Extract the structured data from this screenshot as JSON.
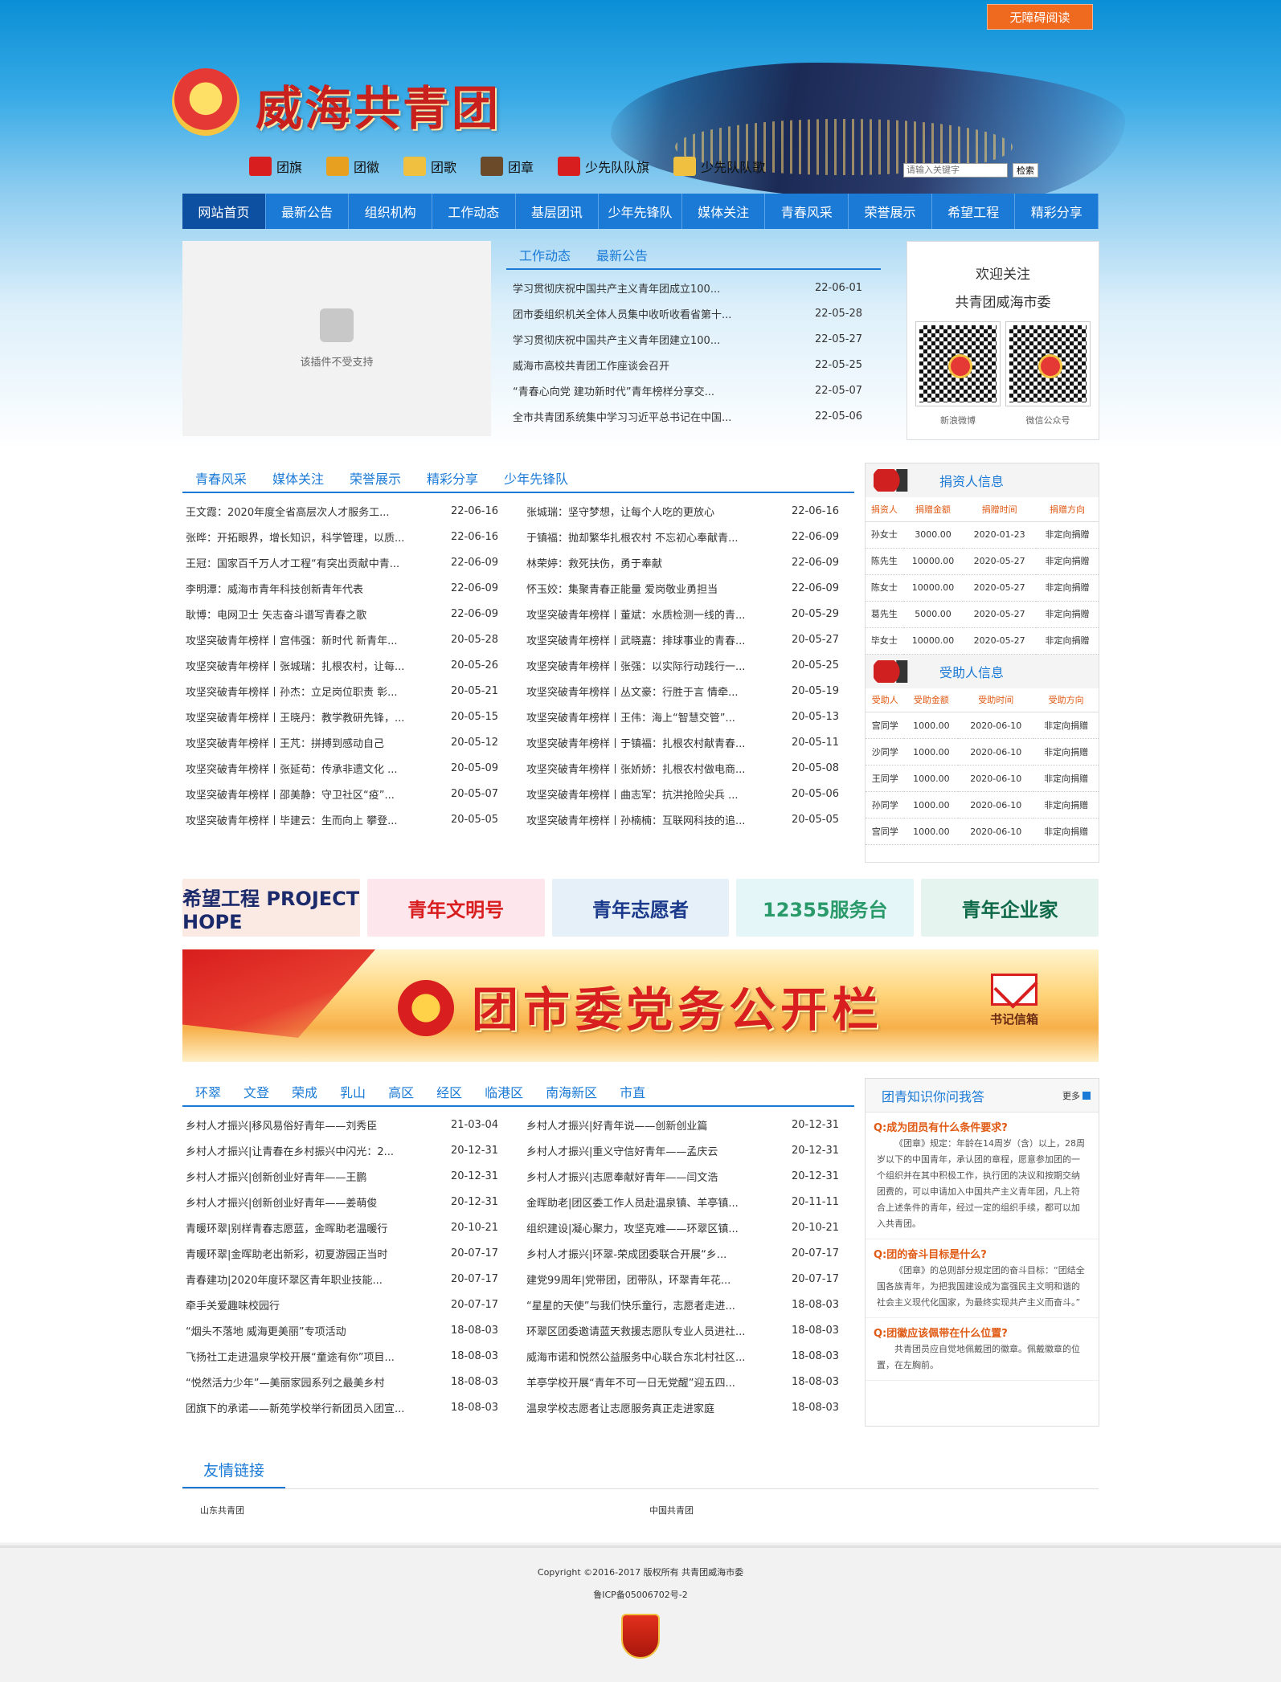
{
  "header": {
    "accessibility_button": "无障碍阅读",
    "site_title": "威海共青团",
    "quick_links": [
      {
        "label": "团旗",
        "color": "#d81e1e"
      },
      {
        "label": "团徽",
        "color": "#e8a020"
      },
      {
        "label": "团歌",
        "color": "#f0c040"
      },
      {
        "label": "团章",
        "color": "#6b4a2a"
      },
      {
        "label": "少先队队旗",
        "color": "#d81e1e"
      },
      {
        "label": "少先队队歌",
        "color": "#f0c040"
      }
    ],
    "search": {
      "placeholder": "请输入关键字",
      "button": "检索"
    }
  },
  "nav": [
    "网站首页",
    "最新公告",
    "组织机构",
    "工作动态",
    "基层团讯",
    "少年先锋队",
    "媒体关注",
    "青春风采",
    "荣誉展示",
    "希望工程",
    "精彩分享"
  ],
  "plugin": {
    "message": "该插件不受支持"
  },
  "news": {
    "tabs": [
      "工作动态",
      "最新公告"
    ],
    "items": [
      {
        "title": "学习贯彻庆祝中国共产主义青年团成立100...",
        "date": "22-06-01"
      },
      {
        "title": "团市委组织机关全体人员集中收听收看省第十...",
        "date": "22-05-28"
      },
      {
        "title": "学习贯彻庆祝中国共产主义青年团建立100...",
        "date": "22-05-27"
      },
      {
        "title": "威海市高校共青团工作座谈会召开",
        "date": "22-05-25"
      },
      {
        "title": "“青春心向党 建功新时代”青年榜样分享交...",
        "date": "22-05-07"
      },
      {
        "title": "全市共青团系统集中学习习近平总书记在中国...",
        "date": "22-05-06"
      }
    ]
  },
  "welcome": {
    "line1": "欢迎关注",
    "line2": "共青团威海市委",
    "qr1_label": "新浪微博",
    "qr2_label": "微信公众号"
  },
  "youth": {
    "tabs": [
      "青春风采",
      "媒体关注",
      "荣誉展示",
      "精彩分享",
      "少年先锋队"
    ],
    "left": [
      {
        "title": "王文霞：2020年度全省高层次人才服务工...",
        "date": "22-06-16"
      },
      {
        "title": "张晔：开拓眼界，增长知识，科学管理，以质...",
        "date": "22-06-16"
      },
      {
        "title": "王冠：国家百千万人才工程“有突出贡献中青...",
        "date": "22-06-09"
      },
      {
        "title": "李明潭：威海市青年科技创新青年代表",
        "date": "22-06-09"
      },
      {
        "title": "耿博：电网卫士 矢志奋斗谱写青春之歌",
        "date": "22-06-09"
      },
      {
        "title": "攻坚突破青年榜样丨宫伟强：新时代 新青年...",
        "date": "20-05-28"
      },
      {
        "title": "攻坚突破青年榜样丨张城瑞：扎根农村，让每...",
        "date": "20-05-26"
      },
      {
        "title": "攻坚突破青年榜样丨孙杰：立足岗位职责 彰...",
        "date": "20-05-21"
      },
      {
        "title": "攻坚突破青年榜样丨王晓丹：教学教研先锋，...",
        "date": "20-05-15"
      },
      {
        "title": "攻坚突破青年榜样丨王芃：拼搏到感动自己",
        "date": "20-05-12"
      },
      {
        "title": "攻坚突破青年榜样丨张延苟：传承非遗文化 ...",
        "date": "20-05-09"
      },
      {
        "title": "攻坚突破青年榜样丨邵美静：守卫社区“疫”...",
        "date": "20-05-07"
      },
      {
        "title": "攻坚突破青年榜样丨毕建云：生而向上 攀登...",
        "date": "20-05-05"
      }
    ],
    "right": [
      {
        "title": "张城瑞：坚守梦想，让每个人吃的更放心",
        "date": "22-06-16"
      },
      {
        "title": "于镇福：抛却繁华扎根农村 不忘初心奉献青...",
        "date": "22-06-09"
      },
      {
        "title": "林荣婷：救死扶伤，勇于奉献",
        "date": "22-06-09"
      },
      {
        "title": "怀玉姣：集聚青春正能量 爱岗敬业勇担当",
        "date": "22-06-09"
      },
      {
        "title": "攻坚突破青年榜样丨董斌：水质检测一线的青...",
        "date": "20-05-29"
      },
      {
        "title": "攻坚突破青年榜样丨武晓嘉：排球事业的青春...",
        "date": "20-05-27"
      },
      {
        "title": "攻坚突破青年榜样丨张强：以实际行动践行一...",
        "date": "20-05-25"
      },
      {
        "title": "攻坚突破青年榜样丨丛文豪：行胜于言 情牵...",
        "date": "20-05-19"
      },
      {
        "title": "攻坚突破青年榜样丨王伟：海上“智慧交管”...",
        "date": "20-05-13"
      },
      {
        "title": "攻坚突破青年榜样丨于镇福：扎根农村献青春...",
        "date": "20-05-11"
      },
      {
        "title": "攻坚突破青年榜样丨张娇娇：扎根农村做电商...",
        "date": "20-05-08"
      },
      {
        "title": "攻坚突破青年榜样丨曲志军：抗洪抢险尖兵 ...",
        "date": "20-05-06"
      },
      {
        "title": "攻坚突破青年榜样丨孙楠楠：互联网科技的追...",
        "date": "20-05-05"
      }
    ]
  },
  "donors": {
    "logo_text": "希望工程",
    "title": "捐资人信息",
    "headers": [
      "捐资人",
      "捐赠金额",
      "捐赠时间",
      "捐赠方向"
    ],
    "rows": [
      [
        "孙女士",
        "3000.00",
        "2020-01-23",
        "非定向捐赠"
      ],
      [
        "陈先生",
        "10000.00",
        "2020-05-27",
        "非定向捐赠"
      ],
      [
        "陈女士",
        "10000.00",
        "2020-05-27",
        "非定向捐赠"
      ],
      [
        "葛先生",
        "5000.00",
        "2020-05-27",
        "非定向捐赠"
      ],
      [
        "毕女士",
        "10000.00",
        "2020-05-27",
        "非定向捐赠"
      ]
    ]
  },
  "recipients": {
    "title": "受助人信息",
    "headers": [
      "受助人",
      "受助金额",
      "受助时间",
      "受助方向"
    ],
    "rows": [
      [
        "宫同学",
        "1000.00",
        "2020-06-10",
        "非定向捐赠"
      ],
      [
        "沙同学",
        "1000.00",
        "2020-06-10",
        "非定向捐赠"
      ],
      [
        "王同学",
        "1000.00",
        "2020-06-10",
        "非定向捐赠"
      ],
      [
        "孙同学",
        "1000.00",
        "2020-06-10",
        "非定向捐赠"
      ],
      [
        "宫同学",
        "1000.00",
        "2020-06-10",
        "非定向捐赠"
      ]
    ]
  },
  "banners": [
    {
      "label": "希望工程 PROJECT HOPE",
      "bg": "#fbe9e4",
      "color": "#1b2a6b"
    },
    {
      "label": "青年文明号",
      "bg": "#fde6ec",
      "color": "#d81e1e"
    },
    {
      "label": "青年志愿者",
      "bg": "#e6f0f8",
      "color": "#1b3a8b"
    },
    {
      "label": "12355服务台",
      "bg": "#e4f6f8",
      "color": "#2a9a6a"
    },
    {
      "label": "青年企业家",
      "bg": "#e6f4ef",
      "color": "#0f6a4a"
    }
  ],
  "party_banner": {
    "title": "团市委党务公开栏",
    "mail_label": "书记信箱"
  },
  "county": {
    "tabs": [
      "环翠",
      "文登",
      "荣成",
      "乳山",
      "高区",
      "经区",
      "临港区",
      "南海新区",
      "市直"
    ],
    "left": [
      {
        "title": "乡村人才振兴|移风易俗好青年——刘秀臣",
        "date": "21-03-04"
      },
      {
        "title": "乡村人才振兴|让青春在乡村振兴中闪光：2...",
        "date": "20-12-31"
      },
      {
        "title": "乡村人才振兴|创新创业好青年——王鹏",
        "date": "20-12-31"
      },
      {
        "title": "乡村人才振兴|创新创业好青年——姜萌俊",
        "date": "20-12-31"
      },
      {
        "title": "青暖环翠|别样青春志愿蓝，金晖助老温暖行",
        "date": "20-10-21"
      },
      {
        "title": "青暖环翠|金晖助老出新彩，初夏游园正当时",
        "date": "20-07-17"
      },
      {
        "title": "青春建功|2020年度环翠区青年职业技能...",
        "date": "20-07-17"
      },
      {
        "title": "牵手关爱趣味校园行",
        "date": "20-07-17"
      },
      {
        "title": "“烟头不落地 威海更美丽”专项活动",
        "date": "18-08-03"
      },
      {
        "title": "飞扬社工走进温泉学校开展“童途有你”项目...",
        "date": "18-08-03"
      },
      {
        "title": "“悦然活力少年”—美丽家园系列之最美乡村",
        "date": "18-08-03"
      },
      {
        "title": "团旗下的承诺——新苑学校举行新团员入团宣...",
        "date": "18-08-03"
      }
    ],
    "right": [
      {
        "title": "乡村人才振兴|好青年说——创新创业篇",
        "date": "20-12-31"
      },
      {
        "title": "乡村人才振兴|重义守信好青年——孟庆云",
        "date": "20-12-31"
      },
      {
        "title": "乡村人才振兴|志愿奉献好青年——闫文浩",
        "date": "20-12-31"
      },
      {
        "title": "金晖助老|团区委工作人员赴温泉镇、羊亭镇...",
        "date": "20-11-11"
      },
      {
        "title": "组织建设|凝心聚力，攻坚克难——环翠区镇...",
        "date": "20-10-21"
      },
      {
        "title": "乡村人才振兴|环翠-荣成团委联合开展“乡...",
        "date": "20-07-17"
      },
      {
        "title": "建党99周年|党带团，团带队，环翠青年花...",
        "date": "20-07-17"
      },
      {
        "title": "“星星的天使”与我们快乐童行，志愿者走进...",
        "date": "18-08-03"
      },
      {
        "title": "环翠区团委邀请蓝天救援志愿队专业人员进社...",
        "date": "18-08-03"
      },
      {
        "title": "威海市诺和悦然公益服务中心联合东北村社区...",
        "date": "18-08-03"
      },
      {
        "title": "羊亭学校开展“青年不可一日无党醒”迎五四...",
        "date": "18-08-03"
      },
      {
        "title": "温泉学校志愿者让志愿服务真正走进家庭",
        "date": "18-08-03"
      }
    ]
  },
  "faq": {
    "title": "团青知识你问我答",
    "more": "更多",
    "items": [
      {
        "q": "Q:成为团员有什么条件要求?",
        "a": "《团章》规定：年龄在14周岁（含）以上，28周岁以下的中国青年，承认团的章程，愿意参加团的一个组织并在其中积极工作，执行团的决议和按期交纳团费的，可以申请加入中国共产主义青年团，凡上符合上述条件的青年，经过一定的组织手续，都可以加入共青团。"
      },
      {
        "q": "Q:团的奋斗目标是什么?",
        "a": "《团章》的总则部分规定团的奋斗目标：“团结全国各族青年，为把我国建设成为富强民主文明和谐的社会主义现代化国家，为最终实现共产主义而奋斗。”"
      },
      {
        "q": "Q:团徽应该佩带在什么位置?",
        "a": "共青团员应自觉地佩戴团的徽章。佩戴徽章的位置，在左胸前。"
      }
    ]
  },
  "links": {
    "title": "友情链接",
    "items": [
      "山东共青团",
      "中国共青团"
    ]
  },
  "footer": {
    "copyright": "Copyright ©2016-2017 版权所有 共青团威海市委",
    "icp": "鲁ICP备05006702号-2"
  }
}
